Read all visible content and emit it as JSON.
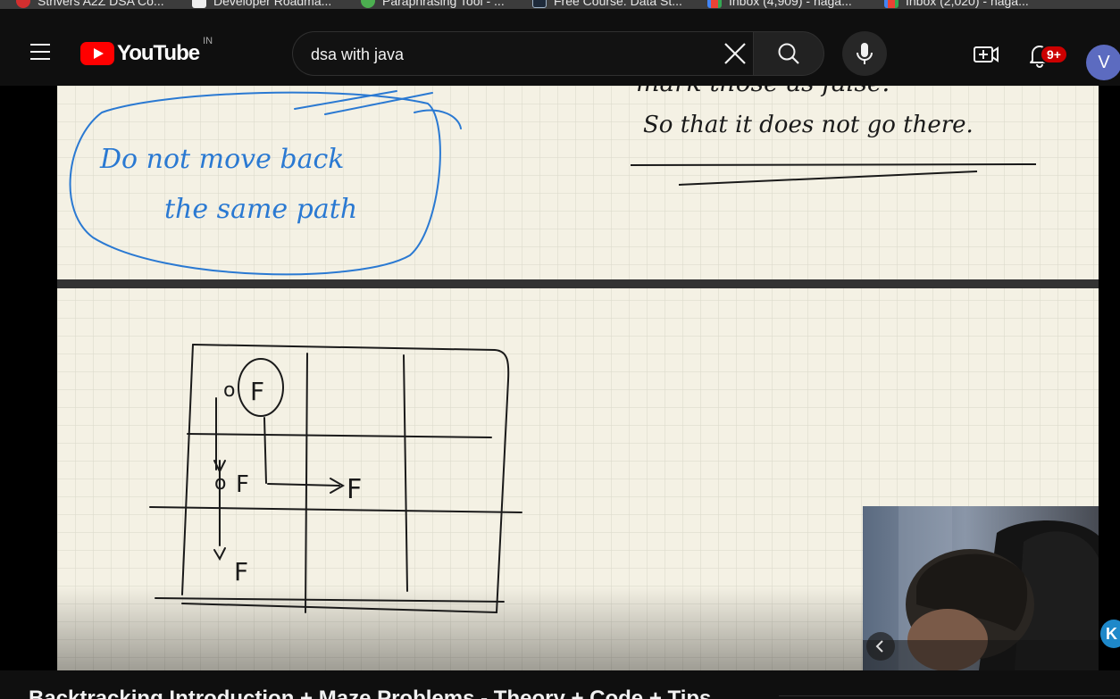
{
  "bookmarks": [
    {
      "label": "Strivers A2Z DSA Co...",
      "icon": "strivers-icon",
      "color": "#d32f2f"
    },
    {
      "label": "Developer Roadma...",
      "icon": "roadmap-icon",
      "color": "#111111"
    },
    {
      "label": "Paraphrasing Tool - ...",
      "icon": "paraphrase-icon",
      "color": "#4caf50"
    },
    {
      "label": "Free Course: Data St...",
      "icon": "course-icon",
      "color": "#1e2a3a"
    },
    {
      "label": "Inbox (4,909) - naga...",
      "icon": "gmail-icon",
      "color": "#ea4335"
    },
    {
      "label": "Inbox (2,020) - naga...",
      "icon": "gmail-icon",
      "color": "#ea4335"
    }
  ],
  "masthead": {
    "logo_text": "YouTube",
    "country_code": "IN",
    "search_value": "dsa with java",
    "notification_count": "9+",
    "avatar_letter": "V"
  },
  "video": {
    "whiteboard_top": {
      "left_note": [
        "Do not move back",
        "the same path"
      ],
      "right_note": [
        "mark those as false.",
        "So that it does not go there."
      ]
    },
    "whiteboard_bottom": {
      "grid_labels": [
        "o",
        "F",
        "o",
        "F",
        "F",
        "F"
      ]
    },
    "creator_badge": "K"
  },
  "below_video": {
    "title": "Backtracking Introduction + Maze Problems - Theory + Code + Tips"
  },
  "colors": {
    "accent_red": "#ff0000",
    "badge_red": "#cc0000",
    "paper": "#f4f1e4",
    "grid_line": "#d8d6c8",
    "ink_blue": "#2a79d2",
    "ink_black": "#1a1a1a"
  }
}
